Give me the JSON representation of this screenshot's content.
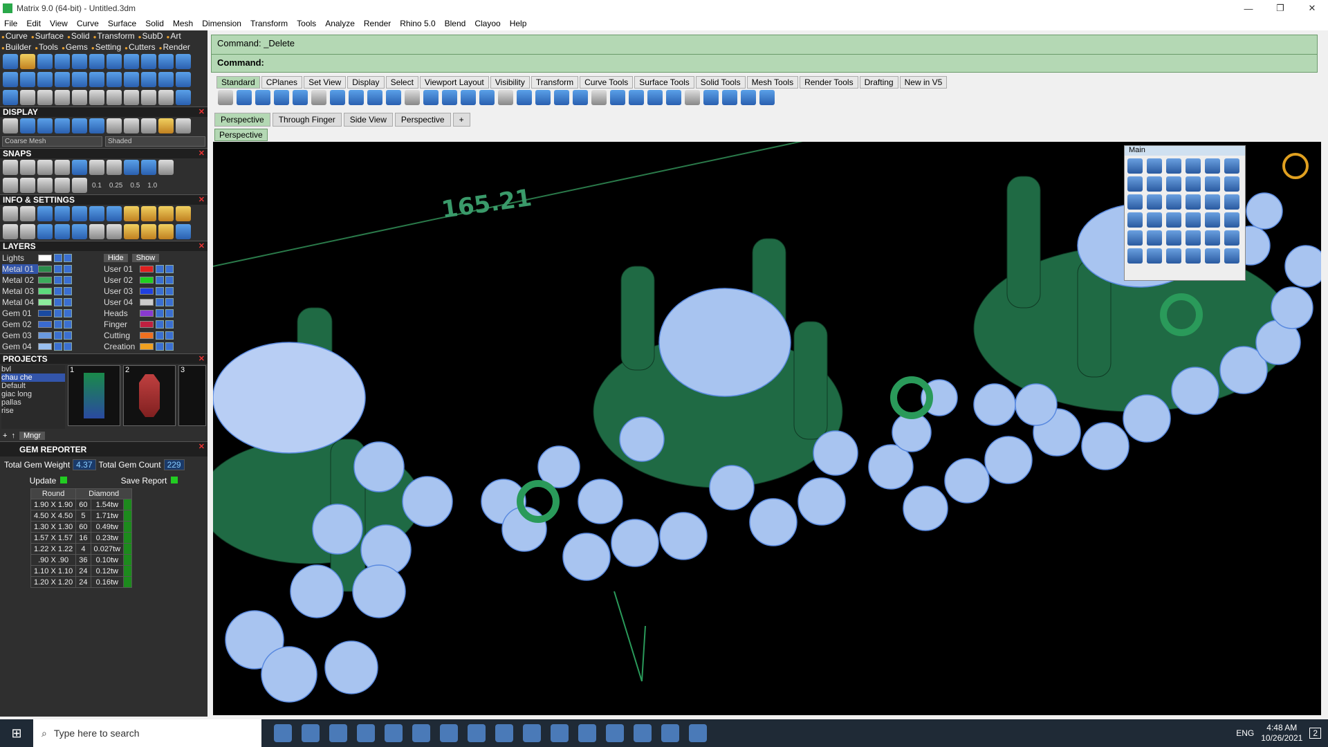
{
  "window": {
    "title": "Matrix 9.0 (64-bit) - Untitled.3dm",
    "min": "—",
    "max": "❐",
    "close": "✕"
  },
  "menu": [
    "File",
    "Edit",
    "View",
    "Curve",
    "Surface",
    "Solid",
    "Mesh",
    "Dimension",
    "Transform",
    "Tools",
    "Analyze",
    "Render",
    "Rhino 5.0",
    "Blend",
    "Clayoo",
    "Help"
  ],
  "left": {
    "tabs1": [
      "Curve",
      "Surface",
      "Solid",
      "Transform",
      "SubD",
      "Art"
    ],
    "tabs2": [
      "Builder",
      "Tools",
      "Gems",
      "Setting",
      "Cutters",
      "Render"
    ],
    "display": {
      "header": "DISPLAY",
      "mesh": "Coarse Mesh",
      "shade": "Shaded"
    },
    "snaps": {
      "header": "SNAPS",
      "values": [
        "0.1",
        "0.25",
        "0.5",
        "1.0"
      ]
    },
    "info": {
      "header": "INFO & SETTINGS"
    },
    "layers": {
      "header": "LAYERS",
      "lights": "Lights",
      "hide": "Hide",
      "show": "Show",
      "rows": [
        {
          "a": "Metal 01",
          "ac": "#2c8c4c",
          "b": "User 01",
          "bc": "#e02020"
        },
        {
          "a": "Metal 02",
          "ac": "#3cac5c",
          "b": "User 02",
          "bc": "#20d020"
        },
        {
          "a": "Metal 03",
          "ac": "#5cdc7c",
          "b": "User 03",
          "bc": "#2040e0"
        },
        {
          "a": "Metal 04",
          "ac": "#8cec9c",
          "b": "User 04",
          "bc": "#cccccc"
        },
        {
          "a": "Gem 01",
          "ac": "#1a4aa0",
          "b": "Heads",
          "bc": "#8a3ad0"
        },
        {
          "a": "Gem 02",
          "ac": "#3a6ad0",
          "b": "Finger",
          "bc": "#c02040"
        },
        {
          "a": "Gem 03",
          "ac": "#6a9ae0",
          "b": "Cutting",
          "bc": "#f07020"
        },
        {
          "a": "Gem 04",
          "ac": "#9ac0f0",
          "b": "Creation",
          "bc": "#f0a020"
        }
      ]
    },
    "projects": {
      "header": "PROJECTS",
      "list": [
        "bvl",
        "chau che",
        "Default",
        "giac long",
        "pallas",
        "rise"
      ],
      "selected": "chau che",
      "thumbs": [
        "1",
        "2",
        "3"
      ],
      "mngr": "Mngr"
    },
    "gem": {
      "header": "GEM REPORTER",
      "weight_label": "Total Gem Weight",
      "weight": "4.37",
      "count_label": "Total Gem Count",
      "count": "229",
      "update": "Update",
      "save": "Save Report",
      "cols": [
        "Round",
        "Diamond"
      ],
      "rows": [
        [
          "1.90 X 1.90",
          "60",
          "1.54tw"
        ],
        [
          "4.50 X 4.50",
          "5",
          "1.71tw"
        ],
        [
          "1.30 X 1.30",
          "60",
          "0.49tw"
        ],
        [
          "1.57 X 1.57",
          "16",
          "0.23tw"
        ],
        [
          "1.22 X 1.22",
          "4",
          "0.027tw"
        ],
        [
          ".90 X .90",
          "36",
          "0.10tw"
        ],
        [
          "1.10 X 1.10",
          "24",
          "0.12tw"
        ],
        [
          "1.20 X 1.20",
          "24",
          "0.16tw"
        ]
      ]
    }
  },
  "command": {
    "line1": "Command: _Delete",
    "line2": "Command:"
  },
  "toolbar_tabs": [
    "Standard",
    "CPlanes",
    "Set View",
    "Display",
    "Select",
    "Viewport Layout",
    "Visibility",
    "Transform",
    "Curve Tools",
    "Surface Tools",
    "Solid Tools",
    "Mesh Tools",
    "Render Tools",
    "Drafting",
    "New in V5"
  ],
  "viewport_tabs": [
    "Perspective",
    "Through Finger",
    "Side View",
    "Perspective",
    "+"
  ],
  "viewport_label": "Perspective",
  "dimension": "165.21",
  "main_palette": {
    "title": "Main"
  },
  "taskbar": {
    "search": "Type here to search",
    "lang": "ENG",
    "time": "4:48 AM",
    "date": "10/26/2021",
    "notif": "2"
  }
}
